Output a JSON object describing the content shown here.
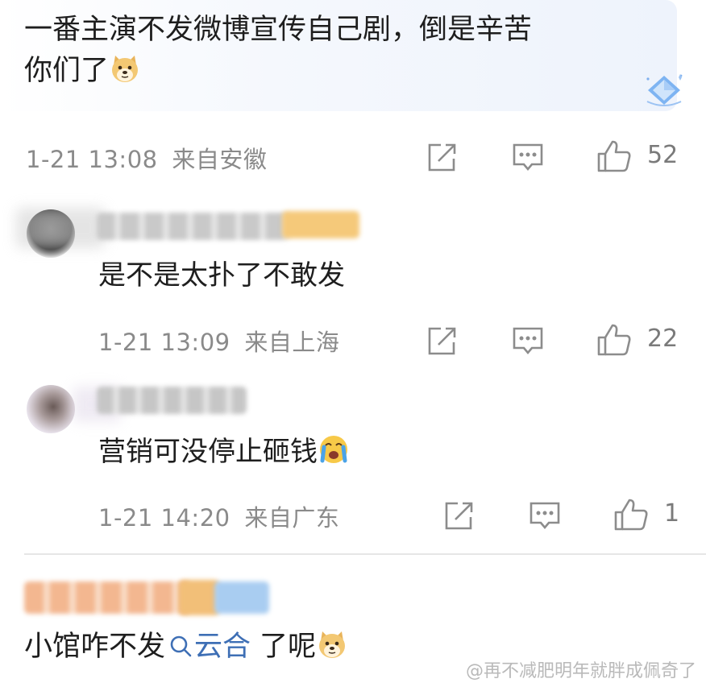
{
  "top_comment": {
    "text_line1": "一番主演不发微博宣传自己剧，倒是辛苦",
    "text_line2": "你们了",
    "emoji": "doge-emoji",
    "badge_icon": "diamond-badge-icon",
    "time": "1-21 13:08",
    "location": "来自安徽",
    "likes": "52"
  },
  "replies": [
    {
      "text": "是不是太扑了不敢发",
      "time": "1-21 13:09",
      "location": "来自上海",
      "likes": "22"
    },
    {
      "text": "营销可没停止砸钱",
      "emoji": "crying-emoji",
      "time": "1-21 14:20",
      "location": "来自广东",
      "likes": "1"
    }
  ],
  "bottom_comment": {
    "text_before": "小馆咋不发",
    "topic_icon": "search-icon",
    "topic": "云合",
    "text_after": " 了呢",
    "emoji": "doge-emoji"
  },
  "watermark": "@再不减肥明年就胖成佩奇了",
  "icons": {
    "repost": "repost-icon",
    "comment": "comment-icon",
    "like": "thumb-up-icon"
  },
  "colors": {
    "meta_gray": "#8a8a8a",
    "topic_blue": "#3e6fb5",
    "card_bg": "#eef3fc"
  }
}
